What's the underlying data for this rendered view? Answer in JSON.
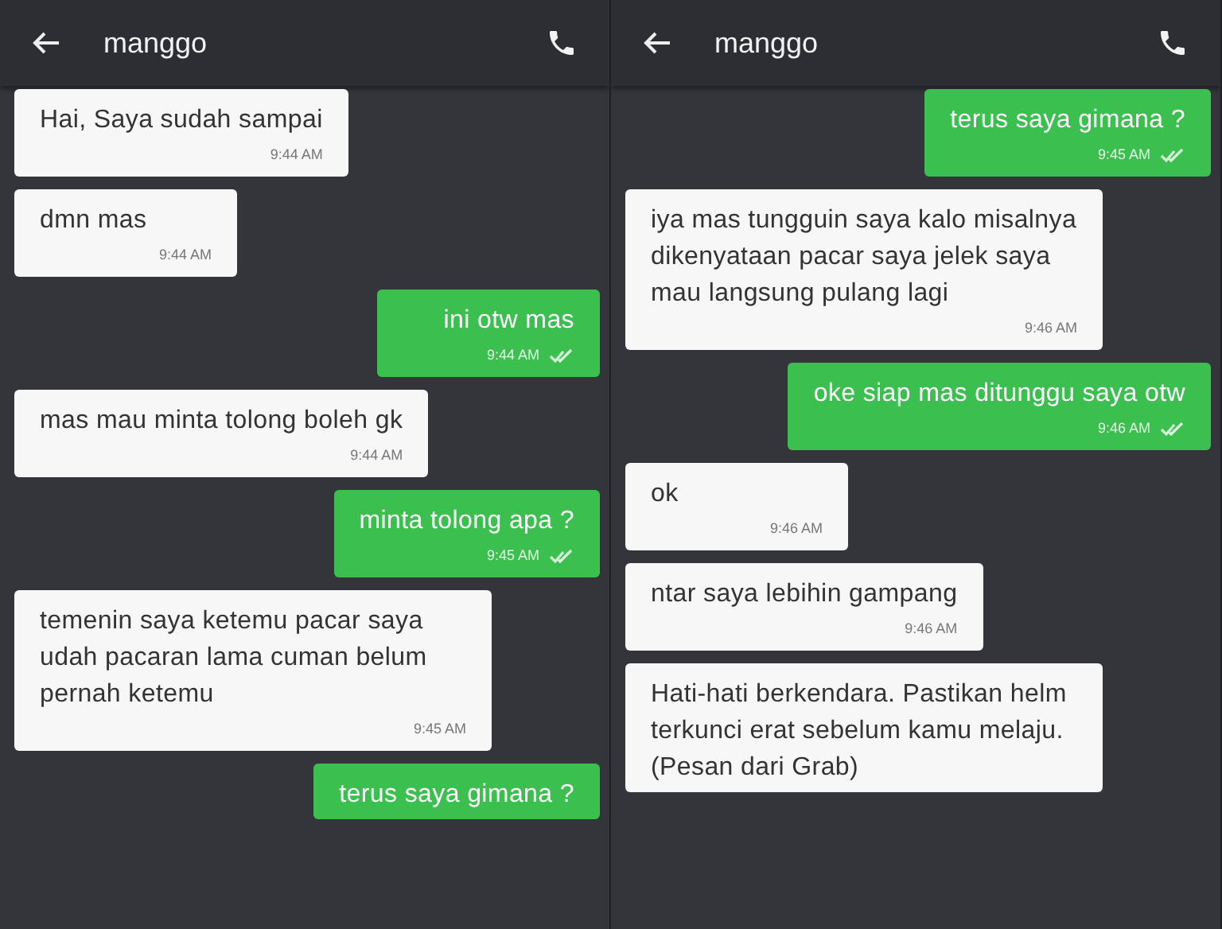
{
  "panels": [
    {
      "title": "manggo",
      "messages": [
        {
          "kind": "incoming",
          "text": "Hai, Saya sudah sampai",
          "time": "9:44 AM"
        },
        {
          "kind": "incoming",
          "text": "dmn mas",
          "time": "9:44 AM"
        },
        {
          "kind": "outgoing",
          "text": "ini otw mas",
          "time": "9:44 AM"
        },
        {
          "kind": "incoming",
          "text": "mas mau minta tolong boleh gk",
          "time": "9:44 AM"
        },
        {
          "kind": "outgoing",
          "text": "minta tolong apa ?",
          "time": "9:45 AM"
        },
        {
          "kind": "incoming",
          "text": "temenin saya ketemu pacar saya udah pacaran lama cuman belum pernah ketemu",
          "time": "9:45 AM"
        },
        {
          "kind": "outgoing",
          "text": "terus saya gimana ?"
        }
      ]
    },
    {
      "title": "manggo",
      "messages": [
        {
          "kind": "outgoing",
          "text": "terus saya gimana ?",
          "time": "9:45 AM"
        },
        {
          "kind": "incoming",
          "text": "iya mas tungguin saya kalo misalnya dikenyataan pacar saya jelek saya mau langsung pulang lagi",
          "time": "9:46 AM"
        },
        {
          "kind": "outgoing",
          "text": "oke siap mas ditunggu saya otw",
          "time": "9:46 AM"
        },
        {
          "kind": "incoming",
          "text": "ok",
          "time": "9:46 AM"
        },
        {
          "kind": "incoming",
          "text": "ntar saya lebihin gampang",
          "time": "9:46 AM"
        },
        {
          "kind": "incoming",
          "text": "Hati-hati berkendara. Pastikan helm terkunci erat sebelum kamu melaju. (Pesan dari Grab)"
        }
      ]
    }
  ]
}
